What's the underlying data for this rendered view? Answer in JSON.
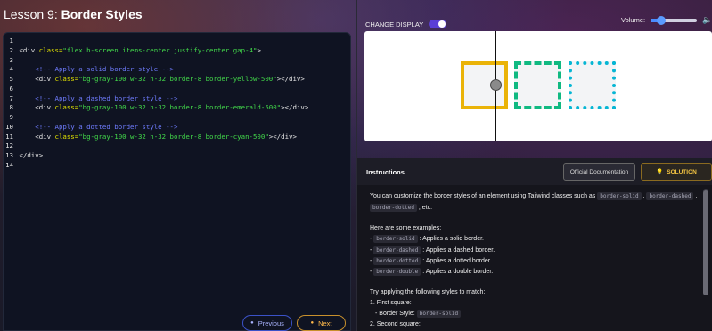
{
  "lesson": {
    "prefix": "Lesson 9: ",
    "title": "Border Styles"
  },
  "editor": {
    "lines": [
      {
        "n": "1",
        "parts": []
      },
      {
        "n": "2",
        "parts": [
          {
            "t": "tag",
            "v": "<div "
          },
          {
            "t": "attr",
            "v": "class="
          },
          {
            "t": "str",
            "v": "\"flex h-screen items-center justify-center gap-4\""
          },
          {
            "t": "tag",
            "v": ">"
          }
        ]
      },
      {
        "n": "3",
        "parts": []
      },
      {
        "n": "4",
        "parts": [
          {
            "t": "cmt",
            "v": "    <!-- Apply a solid border style -->"
          }
        ]
      },
      {
        "n": "5",
        "parts": [
          {
            "t": "tag",
            "v": "    <div "
          },
          {
            "t": "attr",
            "v": "class="
          },
          {
            "t": "str",
            "v": "\"bg-gray-100 w-32 h-32 border-8 border-yellow-500\""
          },
          {
            "t": "tag",
            "v": "></div>"
          }
        ]
      },
      {
        "n": "6",
        "parts": []
      },
      {
        "n": "7",
        "parts": [
          {
            "t": "cmt",
            "v": "    <!-- Apply a dashed border style -->"
          }
        ]
      },
      {
        "n": "8",
        "parts": [
          {
            "t": "tag",
            "v": "    <div "
          },
          {
            "t": "attr",
            "v": "class="
          },
          {
            "t": "str",
            "v": "\"bg-gray-100 w-32 h-32 border-8 border-emerald-500\""
          },
          {
            "t": "tag",
            "v": "></div>"
          }
        ]
      },
      {
        "n": "9",
        "parts": []
      },
      {
        "n": "10",
        "parts": [
          {
            "t": "cmt",
            "v": "    <!-- Apply a dotted border style -->"
          }
        ]
      },
      {
        "n": "11",
        "parts": [
          {
            "t": "tag",
            "v": "    <div "
          },
          {
            "t": "attr",
            "v": "class="
          },
          {
            "t": "str",
            "v": "\"bg-gray-100 w-32 h-32 border-8 border-cyan-500\""
          },
          {
            "t": "tag",
            "v": "></div>"
          }
        ]
      },
      {
        "n": "12",
        "parts": []
      },
      {
        "n": "13",
        "parts": [
          {
            "t": "tag",
            "v": "</div>"
          }
        ]
      },
      {
        "n": "14",
        "parts": []
      }
    ]
  },
  "nav": {
    "previous": "Previous",
    "next": "Next"
  },
  "display": {
    "change_label": "CHANGE DISPLAY",
    "volume_label": "Volume:",
    "volume_level": 0.22
  },
  "instructions": {
    "title": "Instructions",
    "docs_button": "Official Documentation",
    "solution_button": "SOLUTION",
    "intro": "You can customize the border styles of an element using Tailwind classes such as",
    "intro_codes": [
      "border-solid",
      "border-dashed"
    ],
    "intro_code3": "border-dotted",
    "intro_end": ", etc.",
    "examples_heading": "Here are some examples:",
    "examples": [
      {
        "code": "border-solid",
        "text": ": Applies a solid border."
      },
      {
        "code": "border-dashed",
        "text": ": Applies a dashed border."
      },
      {
        "code": "border-dotted",
        "text": ": Applies a dotted border."
      },
      {
        "code": "border-double",
        "text": ": Applies a double border."
      }
    ],
    "try_heading": "Try applying the following styles to match:",
    "first": "1. First square:",
    "first_style_label": "- Border Style:",
    "first_style_code": "border-solid",
    "second": "2. Second square:"
  }
}
